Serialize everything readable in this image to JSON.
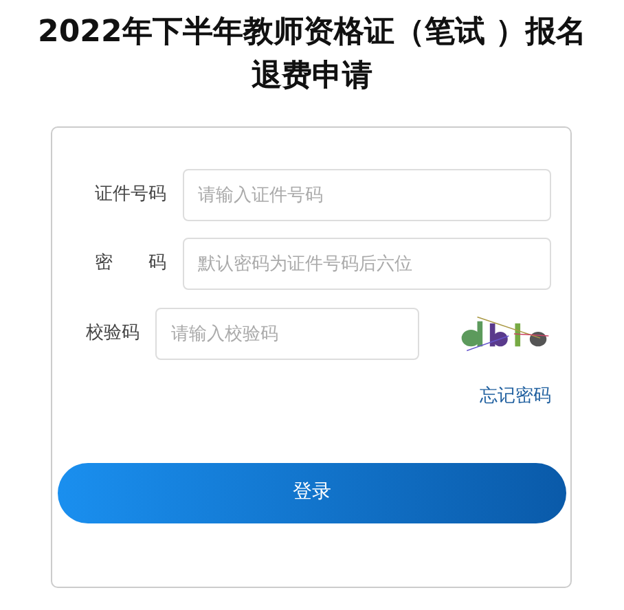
{
  "title": "2022年下半年教师资格证（笔试 ）报名退费申请",
  "fields": [
    {
      "label": "证件号码",
      "placeholder": "请输入证件号码",
      "kind": "text"
    },
    {
      "label": "密　　码",
      "placeholder": "默认密码为证件号码后六位",
      "kind": "text"
    },
    {
      "label": "校验码",
      "placeholder": "请输入校验码",
      "kind": "captcha"
    }
  ],
  "forgot_link": "忘记密码",
  "login_button": "登录"
}
